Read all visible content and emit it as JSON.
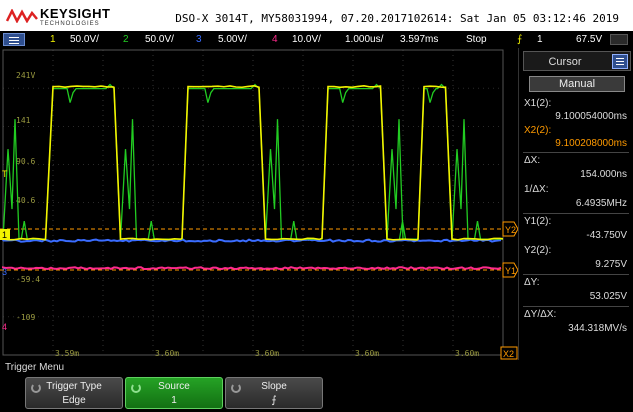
{
  "header": {
    "brand": "KEYSIGHT",
    "brand_sub": "TECHNOLOGIES",
    "instrument_line": "DSO-X 3014T, MY58031994, 07.20.2017102614: Sat Jan 05 03:12:46 2019"
  },
  "status_bar": {
    "ch1_num": "1",
    "ch1_scale": "50.0V/",
    "ch2_num": "2",
    "ch2_scale": "50.0V/",
    "ch3_num": "3",
    "ch3_scale": "5.00V/",
    "ch4_num": "4",
    "ch4_scale": "10.0V/",
    "timebase": "1.000us/",
    "delay": "3.597ms",
    "run_state": "Stop",
    "trigger_source": "1",
    "trigger_level": "67.5V"
  },
  "colors": {
    "ch1": "#f4f400",
    "ch2": "#22cc22",
    "ch3": "#3a6cff",
    "ch4": "#ff2a8c",
    "cursor": "#ff9a00",
    "grid": "#666666",
    "active_softkey": "#1f8f1f"
  },
  "plot": {
    "grid_labels_y": [
      "241V",
      "141",
      "90.6",
      "40.6",
      "-59.4",
      "-109"
    ],
    "grid_labels_x": [
      "3.59m",
      "3.60m",
      "3.60m",
      "3.60m",
      "3.60m"
    ],
    "trigger_marker": "T",
    "ch1_ground_marker": "1",
    "ch3_ground_marker": "3",
    "ch4_ground_marker": "4",
    "cursor_labels": {
      "y2": "Y2",
      "y1": "Y1",
      "x1": "X1",
      "x2": "X2"
    },
    "traces": {
      "ch1_high_frac": 0.12,
      "ch1_low_frac": 0.62,
      "ch2_baseline_frac": 0.62,
      "ch3_baseline_frac": 0.625,
      "ch4_baseline_frac": 0.715,
      "ch1_segments": [
        {
          "level": "low",
          "from": 0.0,
          "to": 0.085
        },
        {
          "level": "high",
          "from": 0.1,
          "to": 0.222
        },
        {
          "level": "low",
          "from": 0.235,
          "to": 0.358
        },
        {
          "level": "high",
          "from": 0.37,
          "to": 0.512
        },
        {
          "level": "low",
          "from": 0.525,
          "to": 0.638
        },
        {
          "level": "high",
          "from": 0.65,
          "to": 0.755
        },
        {
          "level": "low",
          "from": 0.768,
          "to": 0.83
        },
        {
          "level": "high",
          "from": 0.842,
          "to": 0.885
        },
        {
          "level": "low",
          "from": 0.898,
          "to": 1.0
        }
      ]
    }
  },
  "cursor_panel": {
    "title": "Cursor",
    "mode": "Manual",
    "x1_label": "X1(2):",
    "x1_value": "9.100054000ms",
    "x2_label": "X2(2):",
    "x2_value": "9.100208000ms",
    "dx_label": "ΔX:",
    "dx_value": "154.000ns",
    "inv_dx_label": "1/ΔX:",
    "inv_dx_value": "6.4935MHz",
    "y1_label": "Y1(2):",
    "y1_value": "-43.750V",
    "y2_label": "Y2(2):",
    "y2_value": "9.275V",
    "dy_label": "ΔY:",
    "dy_value": "53.025V",
    "dy_dx_label": "ΔY/ΔX:",
    "dy_dx_value": "344.318MV/s"
  },
  "trigger_menu": {
    "title": "Trigger Menu",
    "softkeys": [
      {
        "label": "Trigger Type",
        "value": "Edge"
      },
      {
        "label": "Source",
        "value": "1"
      },
      {
        "label": "Slope",
        "value": "⨍"
      }
    ]
  }
}
